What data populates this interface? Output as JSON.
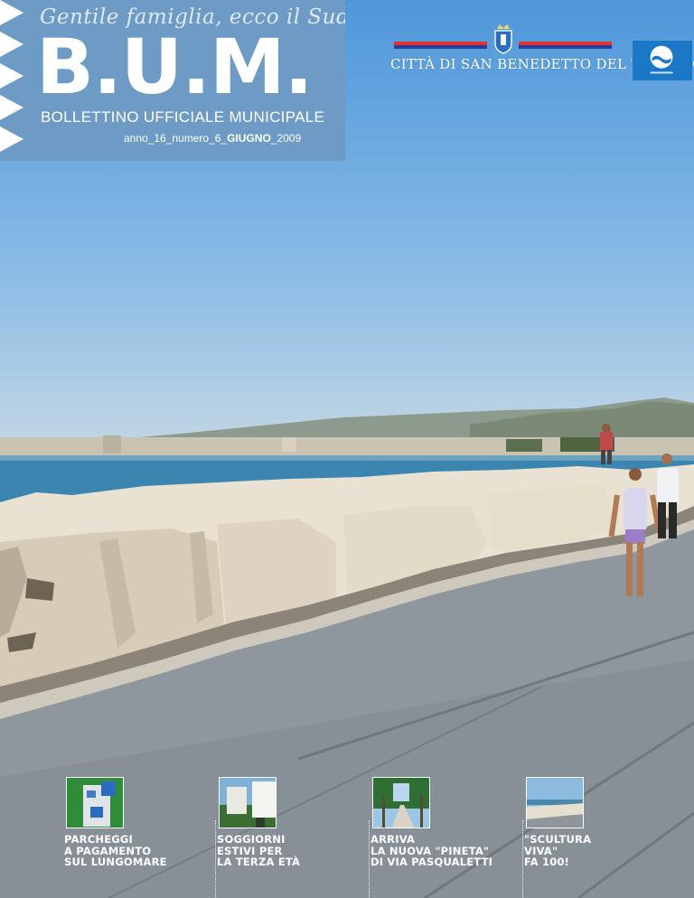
{
  "masthead": {
    "motto": "Gentile famiglia, ecco il Sud",
    "logo": "B.U.M.",
    "subtitle": "BOLLETTINO UFFICIALE MUNICIPALE",
    "issue_prefix": "anno_16_numero_6_",
    "issue_month": "GIUGNO",
    "issue_suffix": "_2009",
    "color": "#6d9bc6"
  },
  "city_header": {
    "name": "CITTÀ DI SAN BENEDETTO DEL TRONTO",
    "crest_icon": "city-crest-icon",
    "flag_colors": [
      "#e03434",
      "#2b3f9a"
    ]
  },
  "badge": {
    "icon": "bandiera-blu-icon",
    "color": "#1b78c7"
  },
  "features": [
    {
      "thumb": "parking-meter-photo",
      "lines": [
        "PARCHEGGI",
        "A PAGAMENTO",
        "SUL LUNGOMARE"
      ]
    },
    {
      "thumb": "hotel-photo",
      "lines": [
        "SOGGIORNI",
        "ESTIVI PER",
        "LA TERZA ETÀ"
      ]
    },
    {
      "thumb": "pine-avenue-photo",
      "lines": [
        "ARRIVA",
        "LA NUOVA \"PINETA\"",
        "DI VIA PASQUALETTI"
      ]
    },
    {
      "thumb": "seafront-photo",
      "lines": [
        "\"SCULTURA",
        "VIVA\"",
        "FA 100!"
      ]
    }
  ],
  "photo": {
    "subject": "seaside-promenade-photo"
  }
}
